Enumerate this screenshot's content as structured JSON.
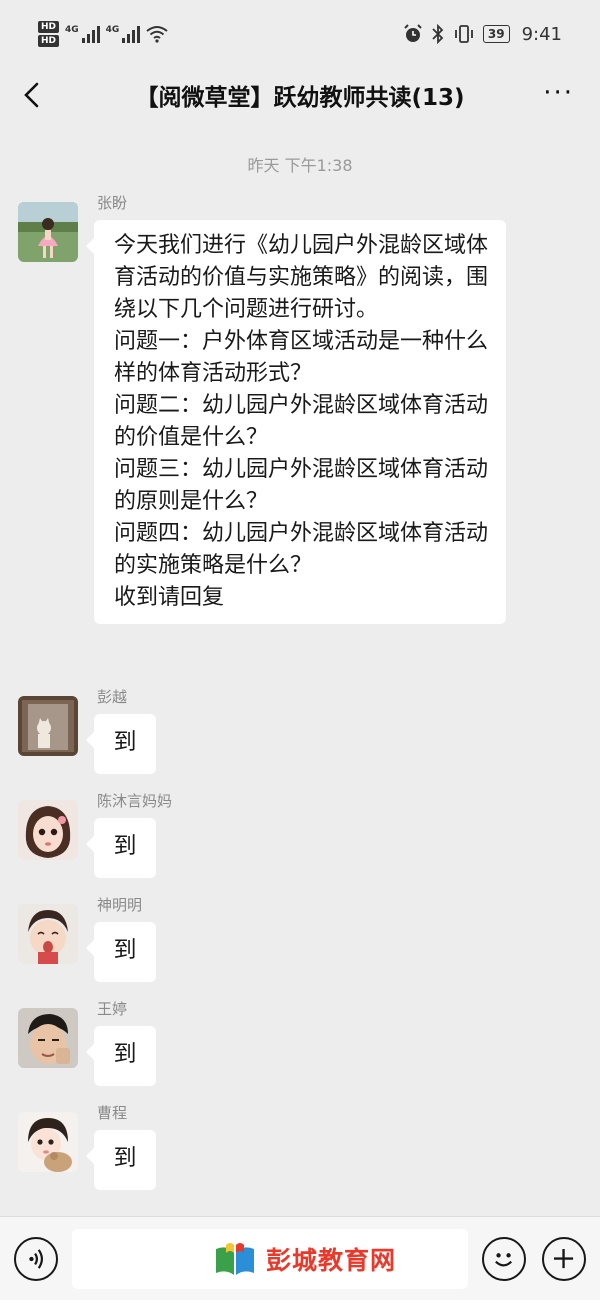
{
  "status_bar": {
    "sim1_label": "HD",
    "sim2_label": "HD",
    "network1": "4G",
    "network2": "4G",
    "battery": "39",
    "time": "9:41"
  },
  "header": {
    "title": "【阅微草堂】跃幼教师共读(13)",
    "more": "···"
  },
  "timestamp": "昨天 下午1:38",
  "messages": [
    {
      "sender": "张盼",
      "text": "今天我们进行《幼儿园户外混龄区域体育活动的价值与实施策略》的阅读，围绕以下几个问题进行研讨。\n问题一：户外体育区域活动是一种什么样的体育活动形式？\n问题二：幼儿园户外混龄区域体育活动的价值是什么？\n问题三：幼儿园户外混龄区域体育活动的原则是什么？\n问题四：幼儿园户外混龄区域体育活动的实施策略是什么？\n收到请回复"
    },
    {
      "sender": "彭越",
      "text": "到"
    },
    {
      "sender": "陈沐言妈妈",
      "text": "到"
    },
    {
      "sender": "神明明",
      "text": "到"
    },
    {
      "sender": "王婷",
      "text": "到"
    },
    {
      "sender": "曹程",
      "text": "到"
    }
  ],
  "input_bar": {
    "watermark": "彭城教育网"
  },
  "icons": {
    "back": "back-arrow-icon",
    "voice": "voice-icon",
    "emoji": "emoji-icon",
    "plus": "plus-icon"
  }
}
